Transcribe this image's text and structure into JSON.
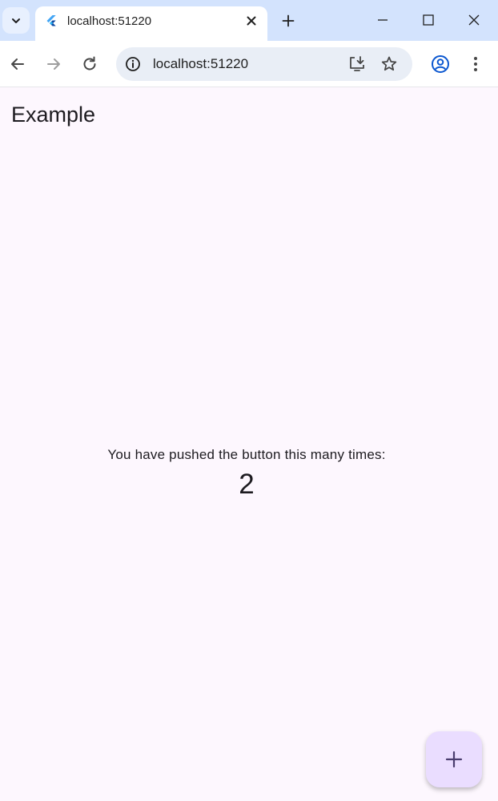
{
  "browser": {
    "tab_title": "localhost:51220",
    "address": "localhost:51220"
  },
  "app": {
    "title": "Example",
    "message": "You have pushed the button this many times:",
    "counter": "2"
  },
  "colors": {
    "tab_strip": "#d3e3fd",
    "page_background": "#fdf7fe",
    "fab_background": "#eaddff",
    "fab_icon": "#4a3d6e"
  },
  "icons": {
    "tab_search": "chevron-down-icon",
    "favicon": "flutter-logo-icon",
    "tab_close": "close-icon",
    "new_tab": "plus-icon",
    "minimize": "minimize-icon",
    "maximize": "maximize-icon",
    "window_close": "close-icon",
    "back": "back-arrow-icon",
    "forward": "forward-arrow-icon",
    "reload": "reload-icon",
    "site_info": "info-icon",
    "install": "install-app-icon",
    "bookmark": "star-icon",
    "profile": "profile-icon",
    "menu": "kebab-menu-icon",
    "fab": "add-icon"
  }
}
